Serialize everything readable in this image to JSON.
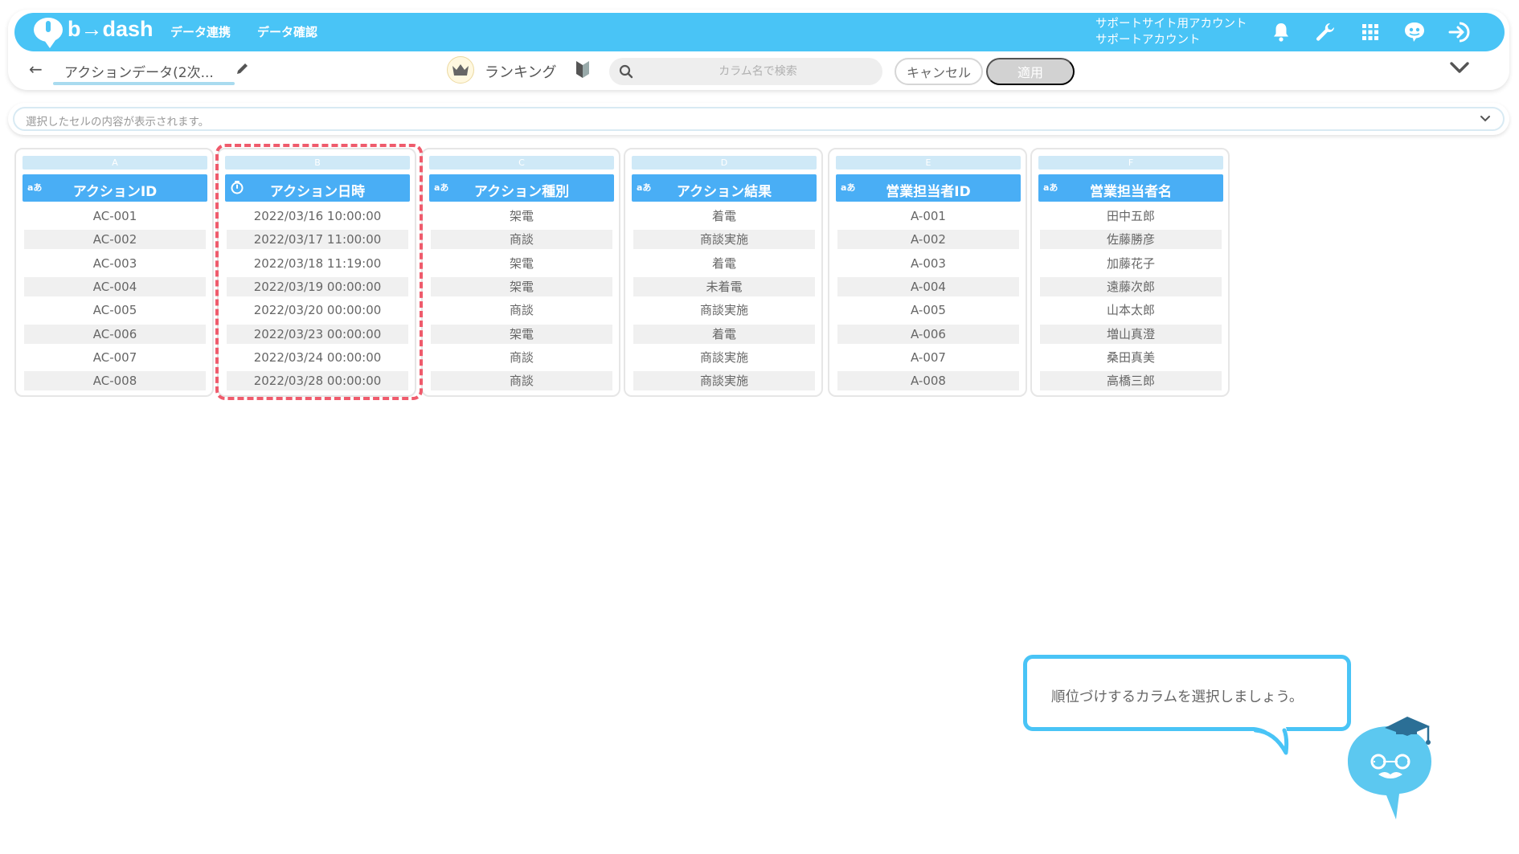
{
  "app": {
    "brand": "b→dash",
    "nav": [
      "データ連携",
      "データ確認"
    ],
    "account_line1": "サポートサイト用アカウント",
    "account_line2": "サポートアカウント",
    "accent_color": "#49c4f6",
    "header_icons": [
      "bell-icon",
      "wrench-icon",
      "grid-icon",
      "mascot-icon",
      "logout-icon"
    ]
  },
  "toolbar": {
    "back_icon": "←",
    "title": "アクションデータ(2次...",
    "mode_label": "ランキング",
    "search_placeholder": "カラム名で検索",
    "cancel_label": "キャンセル",
    "apply_label": "適用"
  },
  "cellbar": {
    "placeholder": "選択したセルの内容が表示されます。"
  },
  "columns": [
    {
      "letter": "A",
      "type_icon": "aあ",
      "name": "アクションID",
      "cells": [
        "AC-001",
        "AC-002",
        "AC-003",
        "AC-004",
        "AC-005",
        "AC-006",
        "AC-007",
        "AC-008"
      ]
    },
    {
      "letter": "B",
      "type_icon": "clock-icon",
      "name": "アクション日時",
      "cells": [
        "2022/03/16 10:00:00",
        "2022/03/17 11:00:00",
        "2022/03/18 11:19:00",
        "2022/03/19 00:00:00",
        "2022/03/20 00:00:00",
        "2022/03/23 00:00:00",
        "2022/03/24 00:00:00",
        "2022/03/28 00:00:00"
      ]
    },
    {
      "letter": "C",
      "type_icon": "aあ",
      "name": "アクション種別",
      "cells": [
        "架電",
        "商談",
        "架電",
        "架電",
        "商談",
        "架電",
        "商談",
        "商談"
      ]
    },
    {
      "letter": "D",
      "type_icon": "aあ",
      "name": "アクション結果",
      "cells": [
        "着電",
        "商談実施",
        "着電",
        "未着電",
        "商談実施",
        "着電",
        "商談実施",
        "商談実施"
      ]
    },
    {
      "letter": "E",
      "type_icon": "aあ",
      "name": "営業担当者ID",
      "cells": [
        "A-001",
        "A-002",
        "A-003",
        "A-004",
        "A-005",
        "A-006",
        "A-007",
        "A-008"
      ]
    },
    {
      "letter": "F",
      "type_icon": "aあ",
      "name": "営業担当者名",
      "cells": [
        "田中五郎",
        "佐藤勝彦",
        "加藤花子",
        "遠藤次郎",
        "山本太郎",
        "増山真澄",
        "桑田真美",
        "高橋三郎"
      ]
    }
  ],
  "hint": {
    "text": "順位づけするカラムを選択しましょう。"
  }
}
